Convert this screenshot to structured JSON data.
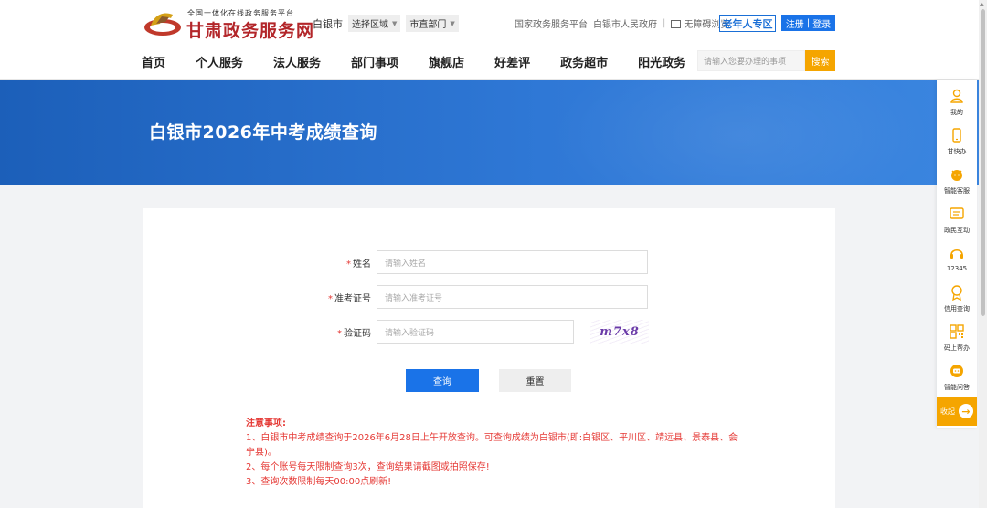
{
  "header": {
    "logo_tagline": "全国一体化在线政务服务平台",
    "logo_title": "甘肃政务服务网",
    "city": "白银市",
    "region_select": "选择区域",
    "dept_select": "市直部门",
    "links": [
      "国家政务服务平台",
      "白银市人民政府"
    ],
    "accessibility": "无障碍浏览",
    "elder_zone": "老年人专区",
    "register": "注册",
    "login": "登录",
    "nav": [
      "首页",
      "个人服务",
      "法人服务",
      "部门事项",
      "旗舰店",
      "好差评",
      "政务超市",
      "阳光政务"
    ],
    "search_placeholder": "请输入您要办理的事项",
    "search_button": "搜索"
  },
  "banner": {
    "title": "白银市2026年中考成绩查询"
  },
  "form": {
    "name_label": "姓名",
    "name_placeholder": "请输入姓名",
    "ticket_label": "准考证号",
    "ticket_placeholder": "请输入准考证号",
    "captcha_label": "验证码",
    "captcha_placeholder": "请输入验证码",
    "captcha_text": "m7x8",
    "query_button": "查询",
    "reset_button": "重置"
  },
  "notice": {
    "title": "注意事项:",
    "items": [
      "1、白银市中考成绩查询于2026年6月28日上午开放查询。可查询成绩为白银市(即:白银区、平川区、靖远县、景泰县、会宁县)。",
      "2、每个账号每天限制查询3次，查询结果请截图或拍照保存!",
      "3、查询次数限制每天00:00点刷新!"
    ]
  },
  "sidebar": {
    "items": [
      {
        "label": "我的",
        "icon": "user-icon"
      },
      {
        "label": "甘快办",
        "icon": "phone-icon"
      },
      {
        "label": "智能客服",
        "icon": "robot-icon"
      },
      {
        "label": "政民互动",
        "icon": "message-icon"
      },
      {
        "label": "12345",
        "icon": "headset-icon"
      },
      {
        "label": "信用查询",
        "icon": "badge-icon"
      },
      {
        "label": "码上帮办",
        "icon": "qrcode-icon"
      },
      {
        "label": "智能问答",
        "icon": "chat-icon"
      }
    ],
    "collapse": "收起"
  },
  "colors": {
    "primary": "#1a73e8",
    "accent": "#f5a500",
    "brand_red": "#b3262a",
    "notice_red": "#e53935"
  }
}
